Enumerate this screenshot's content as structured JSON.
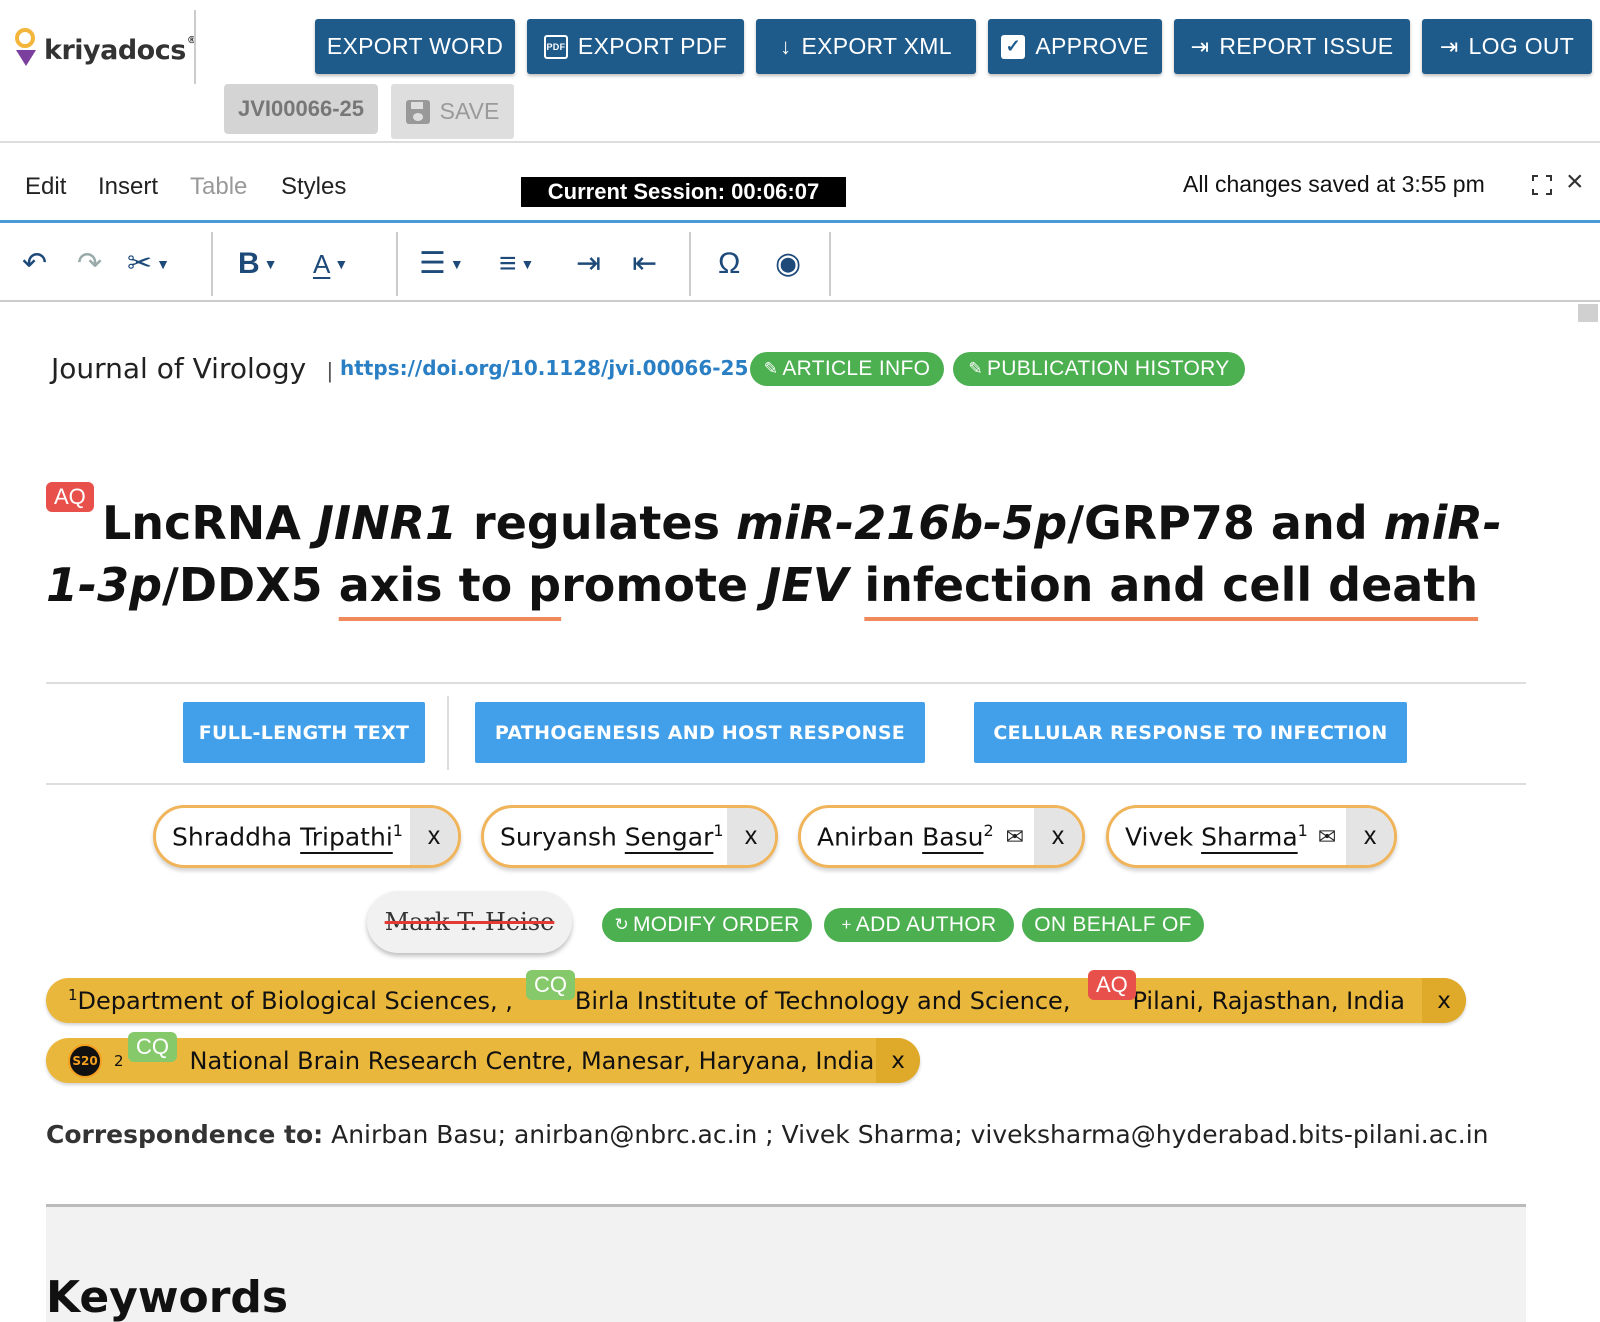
{
  "app": {
    "logo_text": "kriyadocs",
    "logo_reg": "®"
  },
  "header": {
    "buttons": [
      {
        "label": "EXPORT WORD",
        "icon": "none"
      },
      {
        "label": "EXPORT PDF",
        "icon": "pdf-icon"
      },
      {
        "label": "EXPORT XML",
        "icon": "download-arrow-icon"
      },
      {
        "label": "APPROVE",
        "icon": "checkbox-icon"
      },
      {
        "label": "REPORT ISSUE",
        "icon": "sign-in-icon"
      },
      {
        "label": "LOG OUT",
        "icon": "sign-in-icon"
      }
    ],
    "manuscript_id": "JVI00066-25",
    "save_label": "SAVE",
    "pdf_icon_text": "PDF"
  },
  "menu": {
    "items": [
      {
        "label": "Edit",
        "disabled": false
      },
      {
        "label": "Insert",
        "disabled": false
      },
      {
        "label": "Table",
        "disabled": true
      },
      {
        "label": "Styles",
        "disabled": false
      }
    ],
    "session": "Current Session: 00:06:07",
    "saved_status": "All changes saved at 3:55 pm"
  },
  "toolbar": {
    "tools": [
      "undo-icon",
      "redo-icon",
      "scissors-icon",
      "bold-icon",
      "font-color-icon",
      "bullet-list-icon",
      "numbered-list-icon",
      "indent-icon",
      "outdent-icon",
      "omega-icon",
      "eye-icon"
    ],
    "bold_glyph": "B",
    "font_color_glyph": "A",
    "omega_glyph": "Ω"
  },
  "article": {
    "journal": "Journal of Virology",
    "separator": "|",
    "doi": "https://doi.org/10.1128/jvi.00066-25",
    "article_info_label": "ARTICLE INFO",
    "publication_history_label": "PUBLICATION HISTORY",
    "title_badge": "AQ",
    "title_parts": {
      "p1": "LncRNA ",
      "p2": "JINR1",
      "p3": " regulates ",
      "p4": "miR-216b-5p",
      "p5": "/GRP78 and ",
      "p6": "miR-1-3p",
      "p7": "/DDX5 ",
      "p8": "axis to p",
      "p9": "romote ",
      "p10": "JEV",
      "p11": " ",
      "p12": "infection and cell death"
    },
    "categories": [
      "FULL-LENGTH TEXT",
      "PATHOGENESIS AND HOST RESPONSE",
      "CELLULAR RESPONSE TO INFECTION"
    ],
    "authors": [
      {
        "given": "Shraddha ",
        "surname": "Tripathi",
        "sup": "1",
        "email": false
      },
      {
        "given": "Suryansh ",
        "surname": "Sengar",
        "sup": "1",
        "email": false
      },
      {
        "given": "Anirban ",
        "surname": "Basu",
        "sup": "2",
        "email": true
      },
      {
        "given": "Vivek ",
        "surname": "Sharma",
        "sup": "1",
        "email": true
      }
    ],
    "author_remove_label": "x",
    "removed_author": "Mark T. Heise",
    "modify_order_label": "MODIFY ORDER",
    "add_author_label": "ADD AUTHOR",
    "on_behalf_label": "ON BEHALF OF",
    "affiliations": [
      {
        "sup": "1",
        "part1": "Department of Biological Sciences, ,",
        "cq": "CQ",
        "part2": "Birla Institute of Technology and Science,",
        "aq": "AQ",
        "part3": "Pilani, Rajasthan, India"
      },
      {
        "badge": "S20",
        "sup": "2",
        "cq": "CQ",
        "part1": "National Brain Research Centre, Manesar, Haryana, India"
      }
    ],
    "correspondence_label": "Correspondence to:",
    "correspondence_text": " Anirban Basu; anirban@nbrc.ac.in ; Vivek Sharma; viveksharma@hyderabad.bits-pilani.ac.in",
    "keywords_heading": "Keywords"
  }
}
